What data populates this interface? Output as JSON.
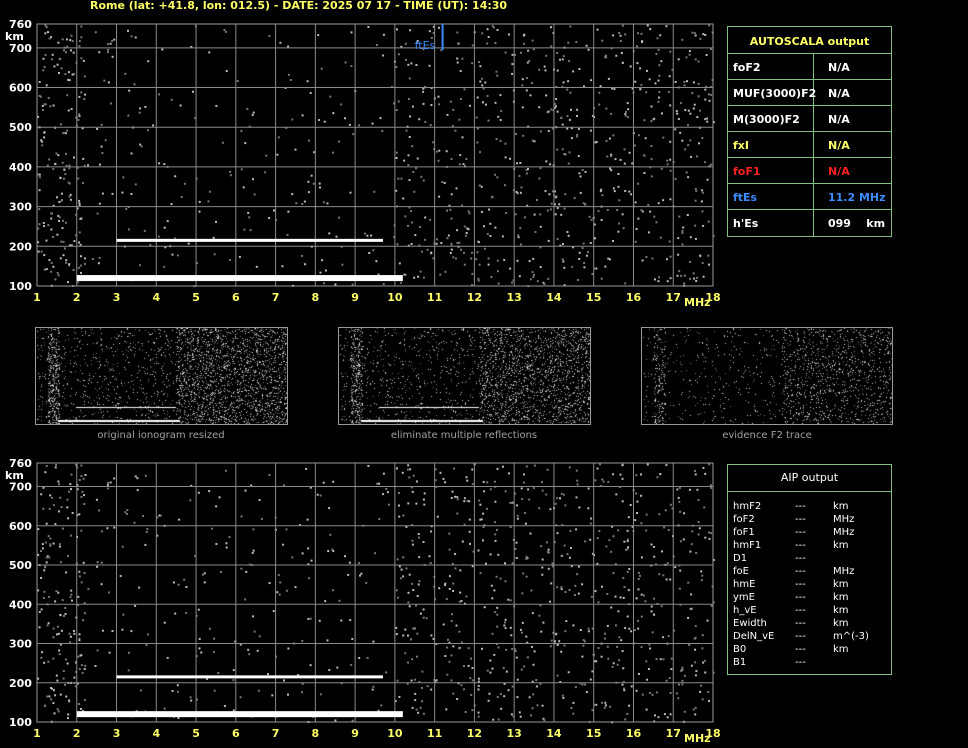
{
  "header": "Rome (lat: +41.8, lon: 012.5) - DATE: 2025 07 17 - TIME (UT): 14:30",
  "chart_data": [
    {
      "type": "scatter",
      "xlabel": "MHz",
      "ylabel": "km",
      "x_ticks": [
        "1",
        "2",
        "3",
        "4",
        "5",
        "6",
        "7",
        "8",
        "9",
        "10",
        "11",
        "12",
        "13",
        "14",
        "15",
        "16",
        "17",
        "18"
      ],
      "y_ticks": [
        "100",
        "200",
        "300",
        "400",
        "500",
        "600",
        "700",
        "760"
      ],
      "xlim": [
        1,
        18
      ],
      "ylim": [
        100,
        760
      ],
      "grid": true,
      "annotation": {
        "label": "ftEs",
        "x": 11.2
      },
      "traces": [
        {
          "name": "",
          "x": [
            2.0,
            10.2
          ],
          "y": [
            115,
            120
          ]
        },
        {
          "name": "",
          "x": [
            3.0,
            9.7
          ],
          "y": [
            210,
            215
          ]
        }
      ]
    },
    {
      "type": "scatter",
      "xlabel": "MHz",
      "ylabel": "km",
      "x_ticks": [
        "1",
        "2",
        "3",
        "4",
        "5",
        "6",
        "7",
        "8",
        "9",
        "10",
        "11",
        "12",
        "13",
        "14",
        "15",
        "16",
        "17",
        "18"
      ],
      "y_ticks": [
        "100",
        "200",
        "300",
        "400",
        "500",
        "600",
        "700",
        "760"
      ],
      "xlim": [
        1,
        18
      ],
      "ylim": [
        100,
        760
      ],
      "grid": true,
      "traces": [
        {
          "name": "",
          "x": [
            2.0,
            10.2
          ],
          "y": [
            115,
            120
          ]
        },
        {
          "name": "",
          "x": [
            3.0,
            9.7
          ],
          "y": [
            210,
            215
          ]
        }
      ]
    }
  ],
  "autoscala": {
    "title": "AUTOSCALA output",
    "rows": [
      {
        "label": "foF2",
        "value": "N/A",
        "color": "#ffffff"
      },
      {
        "label": "MUF(3000)F2",
        "value": "N/A",
        "color": "#ffffff"
      },
      {
        "label": "M(3000)F2",
        "value": "N/A",
        "color": "#ffffff"
      },
      {
        "label": "fxI",
        "value": "N/A",
        "color": "#ffff66"
      },
      {
        "label": "foF1",
        "value": "N/A",
        "color": "#ff2020"
      },
      {
        "label": "ftEs",
        "value": "11.2 MHz",
        "color": "#3b8cff"
      },
      {
        "label": "h'Es",
        "value": "099    km",
        "color": "#ffffff"
      }
    ]
  },
  "thumbnails": {
    "captions": [
      "original ionogram resized",
      "eliminate multiple reflections",
      "evidence F2 trace"
    ]
  },
  "aip": {
    "title": "AIP output",
    "rows": [
      {
        "label": "hmF2",
        "value": "---",
        "unit": "km"
      },
      {
        "label": "foF2",
        "value": "---",
        "unit": "MHz"
      },
      {
        "label": "foF1",
        "value": "---",
        "unit": "MHz"
      },
      {
        "label": "hmF1",
        "value": "---",
        "unit": "km"
      },
      {
        "label": "D1",
        "value": "---",
        "unit": ""
      },
      {
        "label": "foE",
        "value": "---",
        "unit": "MHz"
      },
      {
        "label": "hmE",
        "value": "---",
        "unit": "km"
      },
      {
        "label": "ymE",
        "value": "---",
        "unit": "km"
      },
      {
        "label": "h_vE",
        "value": "---",
        "unit": "km"
      },
      {
        "label": "Ewidth",
        "value": "---",
        "unit": "km"
      },
      {
        "label": "DelN_vE",
        "value": "---",
        "unit": "m^(-3)"
      },
      {
        "label": "B0",
        "value": "---",
        "unit": "km"
      },
      {
        "label": "B1",
        "value": "---",
        "unit": ""
      }
    ]
  },
  "colors": {
    "grid": "#8a8a8a",
    "axis_text": "#ffff66",
    "border": "#7fbf7f",
    "ftes": "#3b8cff"
  }
}
